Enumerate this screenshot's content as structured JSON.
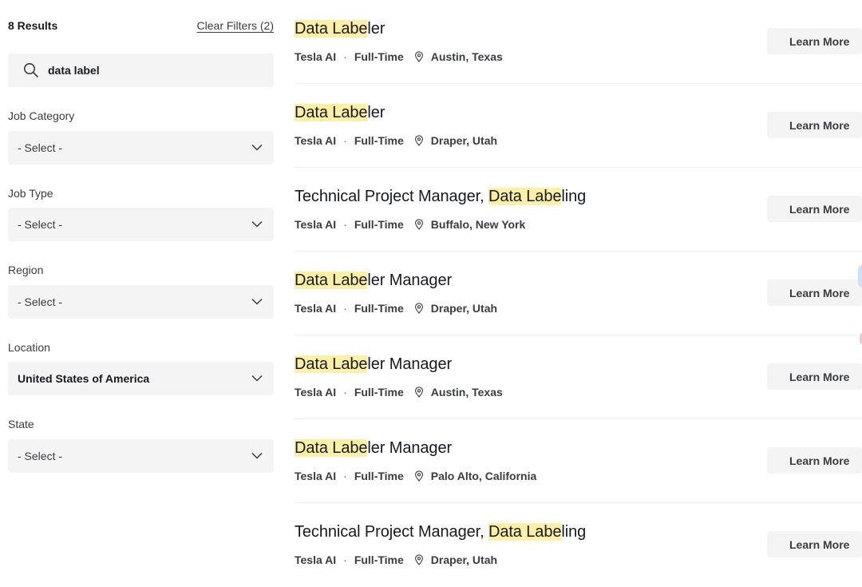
{
  "filters": {
    "results_count": "8 Results",
    "clear_filters": "Clear Filters (2)",
    "search": {
      "value": "data label",
      "placeholder": "Search"
    },
    "groups": [
      {
        "label": "Job Category",
        "value": "- Select -",
        "selected": false
      },
      {
        "label": "Job Type",
        "value": "- Select -",
        "selected": false
      },
      {
        "label": "Region",
        "value": "- Select -",
        "selected": false
      },
      {
        "label": "Location",
        "value": "United States of America",
        "selected": true
      },
      {
        "label": "State",
        "value": "- Select -",
        "selected": false
      }
    ]
  },
  "jobs": [
    {
      "title_pre": "",
      "title_highlight": "Data Labe",
      "title_post": "ler",
      "org": "Tesla AI",
      "type": "Full-Time",
      "location": "Austin, Texas",
      "action": "Learn More"
    },
    {
      "title_pre": "",
      "title_highlight": "Data Labe",
      "title_post": "ler",
      "org": "Tesla AI",
      "type": "Full-Time",
      "location": "Draper, Utah",
      "action": "Learn More"
    },
    {
      "title_pre": "Technical Project Manager, ",
      "title_highlight": "Data Labe",
      "title_post": "ling",
      "org": "Tesla AI",
      "type": "Full-Time",
      "location": "Buffalo, New York",
      "action": "Learn More"
    },
    {
      "title_pre": "",
      "title_highlight": "Data Labe",
      "title_post": "ler Manager",
      "org": "Tesla AI",
      "type": "Full-Time",
      "location": "Draper, Utah",
      "action": "Learn More"
    },
    {
      "title_pre": "",
      "title_highlight": "Data Labe",
      "title_post": "ler Manager",
      "org": "Tesla AI",
      "type": "Full-Time",
      "location": "Austin, Texas",
      "action": "Learn More"
    },
    {
      "title_pre": "",
      "title_highlight": "Data Labe",
      "title_post": "ler Manager",
      "org": "Tesla AI",
      "type": "Full-Time",
      "location": "Palo Alto, California",
      "action": "Learn More"
    },
    {
      "title_pre": "Technical Project Manager, ",
      "title_highlight": "Data Labe",
      "title_post": "ling",
      "org": "Tesla AI",
      "type": "Full-Time",
      "location": "Draper, Utah",
      "action": "Learn More"
    }
  ],
  "icons": {
    "search": "search-icon",
    "dropdown": "chevron-down-icon",
    "location": "map-pin-icon"
  },
  "colors": {
    "highlight": "#fdf0a6",
    "field_bg": "#f4f4f4",
    "text": "#171a20",
    "muted": "#393c41"
  }
}
